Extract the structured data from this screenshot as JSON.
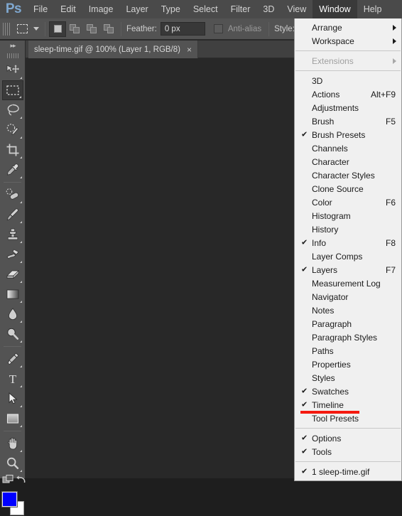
{
  "app": {
    "logo_text": "Ps"
  },
  "menubar": {
    "items": [
      {
        "label": "File",
        "active": false
      },
      {
        "label": "Edit",
        "active": false
      },
      {
        "label": "Image",
        "active": false
      },
      {
        "label": "Layer",
        "active": false
      },
      {
        "label": "Type",
        "active": false
      },
      {
        "label": "Select",
        "active": false
      },
      {
        "label": "Filter",
        "active": false
      },
      {
        "label": "3D",
        "active": false
      },
      {
        "label": "View",
        "active": false
      },
      {
        "label": "Window",
        "active": true
      },
      {
        "label": "Help",
        "active": false
      }
    ]
  },
  "options_bar": {
    "feather_label": "Feather:",
    "feather_value": "0 px",
    "antialias_label": "Anti-alias",
    "style_label": "Style:",
    "style_value": "N"
  },
  "document_tab": {
    "title": "sleep-time.gif @ 100% (Layer 1, RGB/8)",
    "close_glyph": "×"
  },
  "toolbar": {
    "collapse_glyph": "▸▸",
    "tools": [
      {
        "name": "move-tool"
      },
      {
        "name": "rectangular-marquee-tool"
      },
      {
        "name": "lasso-tool"
      },
      {
        "name": "quick-selection-tool"
      },
      {
        "name": "crop-tool"
      },
      {
        "name": "eyedropper-tool"
      },
      {
        "name": "spot-healing-brush-tool"
      },
      {
        "name": "brush-tool"
      },
      {
        "name": "clone-stamp-tool"
      },
      {
        "name": "history-brush-tool"
      },
      {
        "name": "eraser-tool"
      },
      {
        "name": "gradient-tool"
      },
      {
        "name": "blur-tool"
      },
      {
        "name": "dodge-tool"
      },
      {
        "name": "pen-tool"
      },
      {
        "name": "horizontal-type-tool"
      },
      {
        "name": "path-selection-tool"
      },
      {
        "name": "rectangle-tool"
      },
      {
        "name": "hand-tool"
      },
      {
        "name": "zoom-tool"
      }
    ],
    "foreground_color": "#0000ff",
    "background_color": "#ffffff"
  },
  "window_menu": {
    "items": [
      {
        "label": "Arrange",
        "checked": false,
        "accel": "",
        "submenu": true,
        "disabled": false
      },
      {
        "label": "Workspace",
        "checked": false,
        "accel": "",
        "submenu": true,
        "disabled": false
      },
      {
        "separator": true
      },
      {
        "label": "Extensions",
        "checked": false,
        "accel": "",
        "submenu": true,
        "disabled": true
      },
      {
        "separator": true
      },
      {
        "label": "3D",
        "checked": false,
        "accel": "",
        "submenu": false,
        "disabled": false
      },
      {
        "label": "Actions",
        "checked": false,
        "accel": "Alt+F9",
        "submenu": false,
        "disabled": false
      },
      {
        "label": "Adjustments",
        "checked": false,
        "accel": "",
        "submenu": false,
        "disabled": false
      },
      {
        "label": "Brush",
        "checked": false,
        "accel": "F5",
        "submenu": false,
        "disabled": false
      },
      {
        "label": "Brush Presets",
        "checked": true,
        "accel": "",
        "submenu": false,
        "disabled": false
      },
      {
        "label": "Channels",
        "checked": false,
        "accel": "",
        "submenu": false,
        "disabled": false
      },
      {
        "label": "Character",
        "checked": false,
        "accel": "",
        "submenu": false,
        "disabled": false
      },
      {
        "label": "Character Styles",
        "checked": false,
        "accel": "",
        "submenu": false,
        "disabled": false
      },
      {
        "label": "Clone Source",
        "checked": false,
        "accel": "",
        "submenu": false,
        "disabled": false
      },
      {
        "label": "Color",
        "checked": false,
        "accel": "F6",
        "submenu": false,
        "disabled": false
      },
      {
        "label": "Histogram",
        "checked": false,
        "accel": "",
        "submenu": false,
        "disabled": false
      },
      {
        "label": "History",
        "checked": false,
        "accel": "",
        "submenu": false,
        "disabled": false
      },
      {
        "label": "Info",
        "checked": true,
        "accel": "F8",
        "submenu": false,
        "disabled": false
      },
      {
        "label": "Layer Comps",
        "checked": false,
        "accel": "",
        "submenu": false,
        "disabled": false
      },
      {
        "label": "Layers",
        "checked": true,
        "accel": "F7",
        "submenu": false,
        "disabled": false
      },
      {
        "label": "Measurement Log",
        "checked": false,
        "accel": "",
        "submenu": false,
        "disabled": false
      },
      {
        "label": "Navigator",
        "checked": false,
        "accel": "",
        "submenu": false,
        "disabled": false
      },
      {
        "label": "Notes",
        "checked": false,
        "accel": "",
        "submenu": false,
        "disabled": false
      },
      {
        "label": "Paragraph",
        "checked": false,
        "accel": "",
        "submenu": false,
        "disabled": false
      },
      {
        "label": "Paragraph Styles",
        "checked": false,
        "accel": "",
        "submenu": false,
        "disabled": false
      },
      {
        "label": "Paths",
        "checked": false,
        "accel": "",
        "submenu": false,
        "disabled": false
      },
      {
        "label": "Properties",
        "checked": false,
        "accel": "",
        "submenu": false,
        "disabled": false
      },
      {
        "label": "Styles",
        "checked": false,
        "accel": "",
        "submenu": false,
        "disabled": false
      },
      {
        "label": "Swatches",
        "checked": true,
        "accel": "",
        "submenu": false,
        "disabled": false
      },
      {
        "label": "Timeline",
        "checked": true,
        "accel": "",
        "submenu": false,
        "disabled": false,
        "highlight": true
      },
      {
        "label": "Tool Presets",
        "checked": false,
        "accel": "",
        "submenu": false,
        "disabled": false
      },
      {
        "separator": true
      },
      {
        "label": "Options",
        "checked": true,
        "accel": "",
        "submenu": false,
        "disabled": false
      },
      {
        "label": "Tools",
        "checked": true,
        "accel": "",
        "submenu": false,
        "disabled": false
      },
      {
        "separator": true
      },
      {
        "label": "1 sleep-time.gif",
        "checked": true,
        "accel": "",
        "submenu": false,
        "disabled": false
      }
    ],
    "check_glyph": "✔",
    "highlight_color": "#f5190f"
  }
}
